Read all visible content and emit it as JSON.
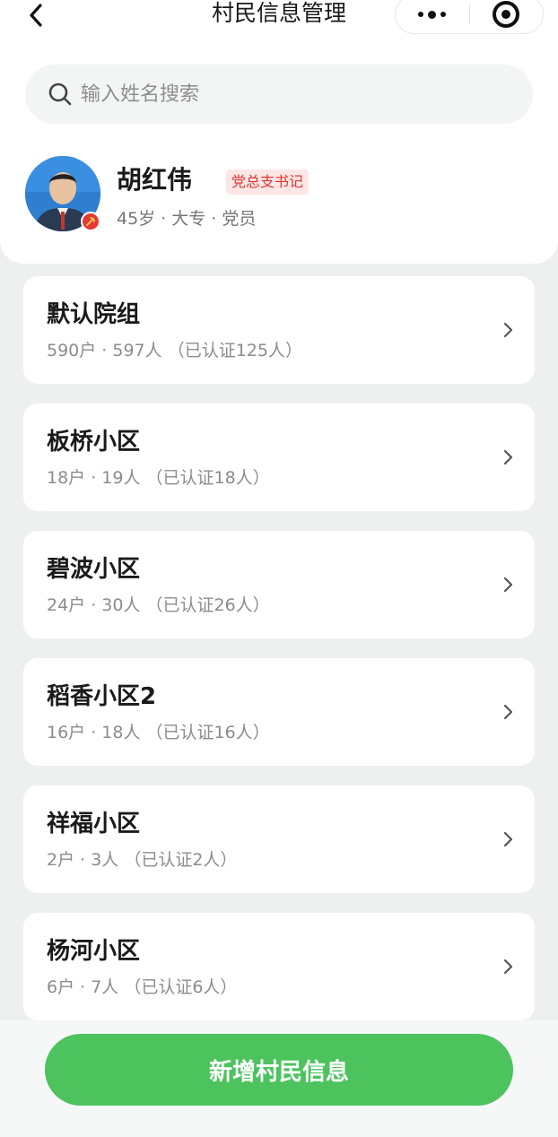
{
  "header": {
    "title": "村民信息管理"
  },
  "search": {
    "placeholder": "输入姓名搜索"
  },
  "profile": {
    "name": "胡红伟",
    "tag": "党总支书记",
    "meta": "45岁 · 大专 · 党员"
  },
  "groups": [
    {
      "name": "默认院组",
      "stats": "590户 · 597人 （已认证125人）"
    },
    {
      "name": "板桥小区",
      "stats": "18户 · 19人 （已认证18人）"
    },
    {
      "name": "碧波小区",
      "stats": "24户 · 30人 （已认证26人）"
    },
    {
      "name": "稻香小区2",
      "stats": "16户 · 18人 （已认证16人）"
    },
    {
      "name": "祥福小区",
      "stats": "2户 · 3人 （已认证2人）"
    },
    {
      "name": "杨河小区",
      "stats": "6户 · 7人 （已认证6人）"
    }
  ],
  "footer": {
    "add_button_label": "新增村民信息"
  },
  "colors": {
    "accent": "#4cc35d",
    "tag_text": "#e3342f",
    "tag_bg": "#fde7e6",
    "party_badge": "#e53935"
  }
}
